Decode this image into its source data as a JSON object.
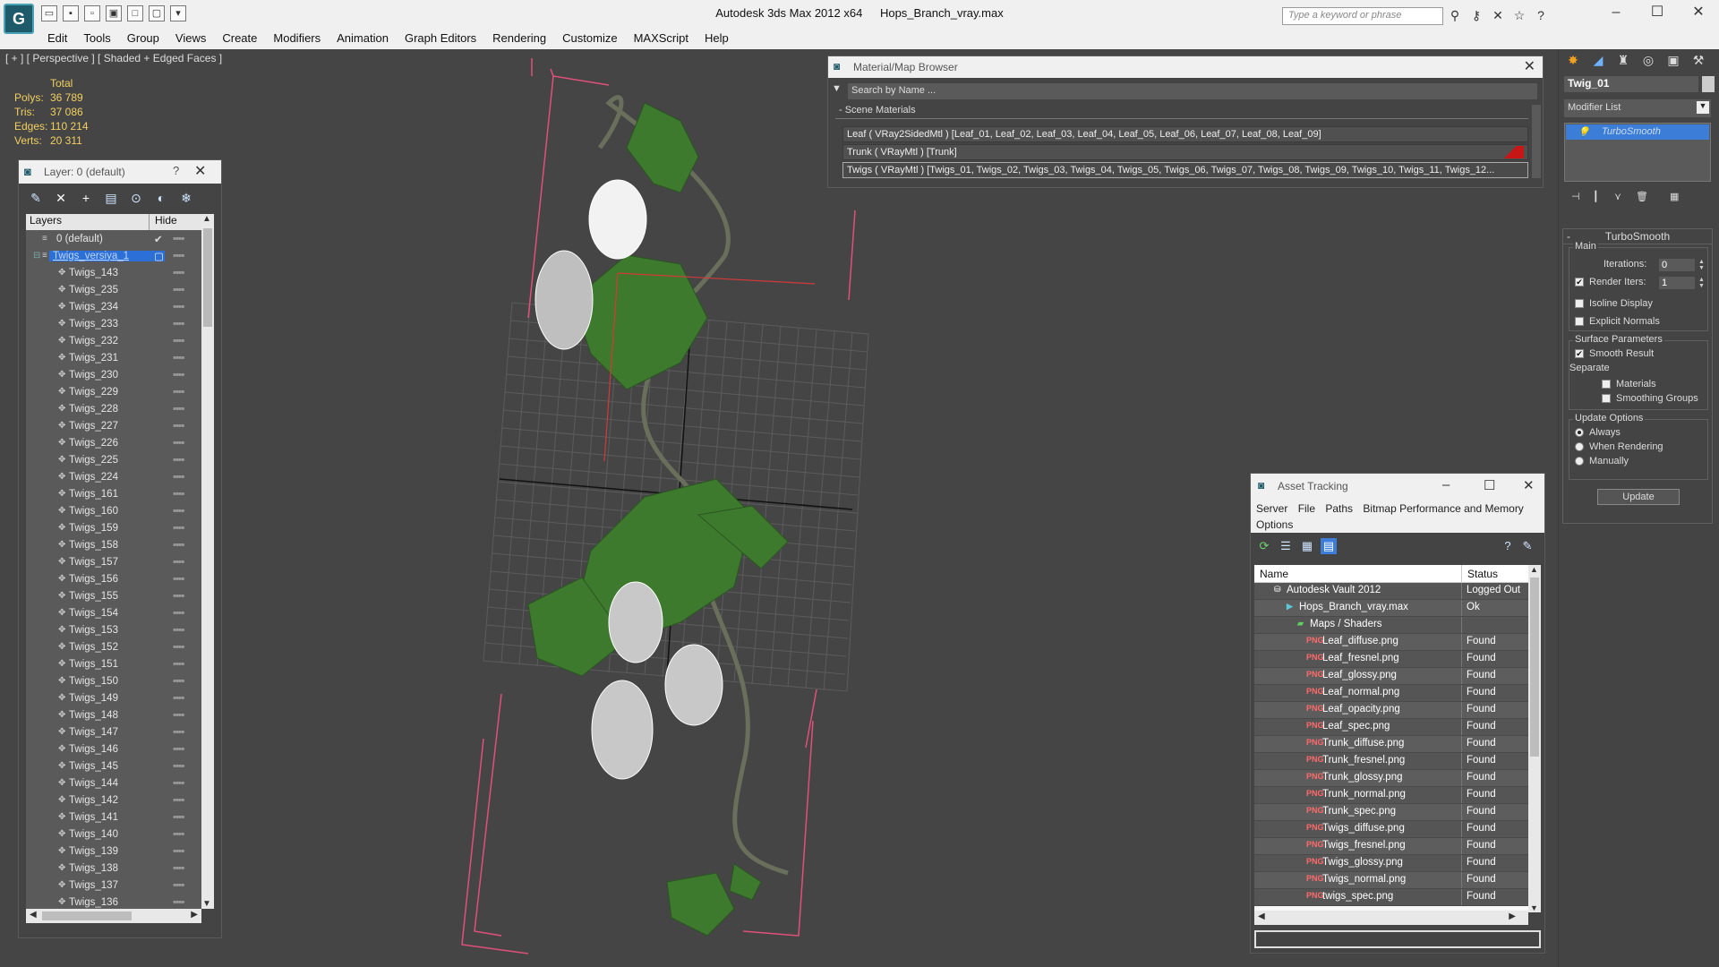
{
  "titlebar": {
    "app_title": "Autodesk 3ds Max  2012 x64",
    "file_name": "Hops_Branch_vray.max",
    "search_placeholder": "Type a keyword or phrase"
  },
  "menubar": [
    "Edit",
    "Tools",
    "Group",
    "Views",
    "Create",
    "Modifiers",
    "Animation",
    "Graph Editors",
    "Rendering",
    "Customize",
    "MAXScript",
    "Help"
  ],
  "viewport": {
    "label": "[ + ] [ Perspective ] [ Shaded + Edged Faces ]",
    "stats_header": "Total",
    "stats": [
      {
        "label": "Polys:",
        "value": "36 789"
      },
      {
        "label": "Tris:",
        "value": "37 086"
      },
      {
        "label": "Edges:",
        "value": "110 214"
      },
      {
        "label": "Verts:",
        "value": "20 311"
      }
    ]
  },
  "layer_explorer": {
    "title": "Layer: 0 (default)",
    "help": "?",
    "col_layers": "Layers",
    "col_hide": "Hide",
    "default_layer": "0 (default)",
    "selected_layer": "Twigs_versiya_1",
    "items": [
      "Twigs_143",
      "Twigs_235",
      "Twigs_234",
      "Twigs_233",
      "Twigs_232",
      "Twigs_231",
      "Twigs_230",
      "Twigs_229",
      "Twigs_228",
      "Twigs_227",
      "Twigs_226",
      "Twigs_225",
      "Twigs_224",
      "Twigs_161",
      "Twigs_160",
      "Twigs_159",
      "Twigs_158",
      "Twigs_157",
      "Twigs_156",
      "Twigs_155",
      "Twigs_154",
      "Twigs_153",
      "Twigs_152",
      "Twigs_151",
      "Twigs_150",
      "Twigs_149",
      "Twigs_148",
      "Twigs_147",
      "Twigs_146",
      "Twigs_145",
      "Twigs_144",
      "Twigs_142",
      "Twigs_141",
      "Twigs_140",
      "Twigs_139",
      "Twigs_138",
      "Twigs_137",
      "Twigs_136"
    ]
  },
  "material_browser": {
    "title": "Material/Map Browser",
    "search_placeholder": "Search by Name ...",
    "section": "- Scene Materials",
    "materials": [
      "Leaf  ( VRay2SidedMtl )  [Leaf_01, Leaf_02, Leaf_03, Leaf_04, Leaf_05, Leaf_06, Leaf_07, Leaf_08, Leaf_09]",
      "Trunk  ( VRayMtl )  [Trunk]",
      "Twigs  ( VRayMtl )  [Twigs_01, Twigs_02, Twigs_03, Twigs_04, Twigs_05, Twigs_06, Twigs_07, Twigs_08, Twigs_09, Twigs_10, Twigs_11, Twigs_12..."
    ]
  },
  "asset_tracking": {
    "title": "Asset Tracking",
    "menu": [
      "Server",
      "File",
      "Paths",
      "Bitmap Performance and Memory",
      "Options"
    ],
    "col_name": "Name",
    "col_status": "Status",
    "rows": [
      {
        "name": "Autodesk Vault 2012",
        "status": "Logged Out",
        "indent": 1
      },
      {
        "name": "Hops_Branch_vray.max",
        "status": "Ok",
        "indent": 2
      },
      {
        "name": "Maps / Shaders",
        "status": "",
        "indent": 3
      },
      {
        "name": "Leaf_diffuse.png",
        "status": "Found",
        "indent": 4
      },
      {
        "name": "Leaf_fresnel.png",
        "status": "Found",
        "indent": 4
      },
      {
        "name": "Leaf_glossy.png",
        "status": "Found",
        "indent": 4
      },
      {
        "name": "Leaf_normal.png",
        "status": "Found",
        "indent": 4
      },
      {
        "name": "Leaf_opacity.png",
        "status": "Found",
        "indent": 4
      },
      {
        "name": "Leaf_spec.png",
        "status": "Found",
        "indent": 4
      },
      {
        "name": "Trunk_diffuse.png",
        "status": "Found",
        "indent": 4
      },
      {
        "name": "Trunk_fresnel.png",
        "status": "Found",
        "indent": 4
      },
      {
        "name": "Trunk_glossy.png",
        "status": "Found",
        "indent": 4
      },
      {
        "name": "Trunk_normal.png",
        "status": "Found",
        "indent": 4
      },
      {
        "name": "Trunk_spec.png",
        "status": "Found",
        "indent": 4
      },
      {
        "name": "Twigs_diffuse.png",
        "status": "Found",
        "indent": 4
      },
      {
        "name": "Twigs_fresnel.png",
        "status": "Found",
        "indent": 4
      },
      {
        "name": "Twigs_glossy.png",
        "status": "Found",
        "indent": 4
      },
      {
        "name": "Twigs_normal.png",
        "status": "Found",
        "indent": 4
      },
      {
        "name": "twigs_spec.png",
        "status": "Found",
        "indent": 4
      }
    ]
  },
  "command_panel": {
    "object_name": "Twig_01",
    "modifier_list": "Modifier List",
    "stack_item": "TurboSmooth",
    "rollout_title": "TurboSmooth",
    "main_group": "Main",
    "iterations_label": "Iterations:",
    "iterations_value": "0",
    "render_iters_label": "Render Iters:",
    "render_iters_value": "1",
    "isoline_display": "Isoline Display",
    "explicit_normals": "Explicit Normals",
    "surface_group": "Surface Parameters",
    "smooth_result": "Smooth Result",
    "separate": "Separate",
    "materials": "Materials",
    "smoothing_groups": "Smoothing Groups",
    "update_group": "Update Options",
    "always": "Always",
    "when_rendering": "When Rendering",
    "manually": "Manually",
    "update_button": "Update"
  }
}
